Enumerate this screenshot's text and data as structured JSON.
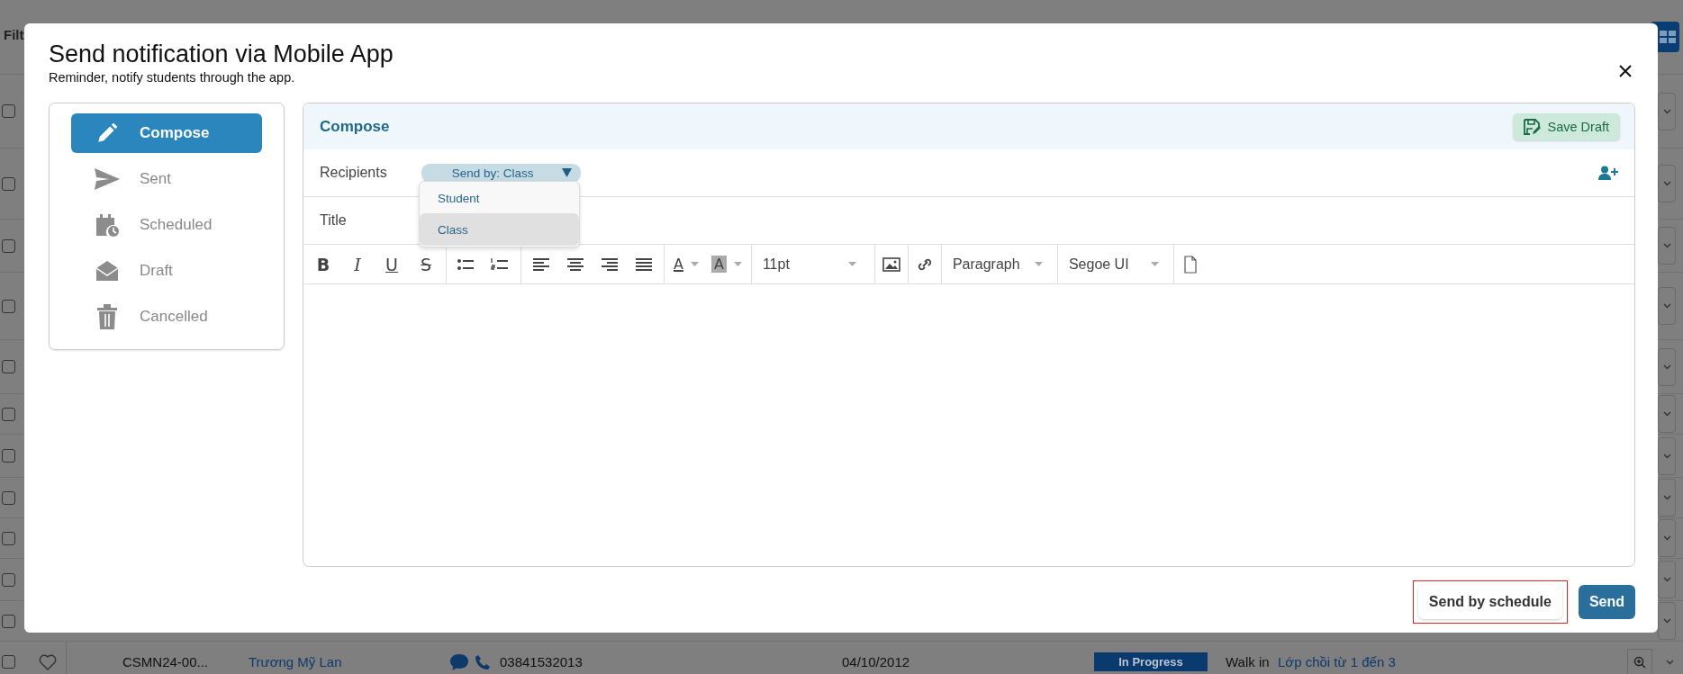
{
  "background": {
    "filter_label": "Filt",
    "rows": [
      {
        "checked": false
      },
      {
        "checked": false
      },
      {
        "checked": false
      },
      {
        "checked": false
      },
      {
        "checked": false
      },
      {
        "checked": false
      },
      {
        "checked": false
      },
      {
        "checked": false
      },
      {
        "checked": false
      },
      {
        "checked": false
      },
      {
        "checked": false
      }
    ],
    "last_row": {
      "checked": false,
      "code": "CSMN24-00...",
      "name": "Trương Mỹ Lan",
      "phone": "03841532013",
      "date": "04/10/2012",
      "status": "In Progress",
      "source": "Walk in",
      "class": "Lớp chồi từ 1 đến 3"
    }
  },
  "dialog": {
    "title": "Send notification via Mobile App",
    "subtitle": "Reminder, notify students through the app.",
    "nav": [
      {
        "label": "Compose",
        "kind": "compose",
        "selected": true
      },
      {
        "label": "Sent",
        "kind": "sent",
        "selected": false
      },
      {
        "label": "Scheduled",
        "kind": "scheduled",
        "selected": false
      },
      {
        "label": "Draft",
        "kind": "draft",
        "selected": false
      },
      {
        "label": "Cancelled",
        "kind": "cancelled",
        "selected": false
      }
    ],
    "compose": {
      "header": "Compose",
      "save_draft": "Save Draft",
      "recipients_label": "Recipients",
      "send_by": "Send by: Class",
      "send_by_options": [
        {
          "label": "Student",
          "selected": false
        },
        {
          "label": "Class",
          "selected": true
        }
      ],
      "title_label": "Title",
      "format_buttons": [
        {
          "label": "B",
          "kind": "bold"
        },
        {
          "label": "I",
          "kind": "italic"
        },
        {
          "label": "U",
          "kind": "underline"
        },
        {
          "label": "S",
          "kind": "strike"
        }
      ],
      "color_buttons": [
        {
          "label": "A",
          "kind": "text_color"
        },
        {
          "label": "A",
          "kind": "highlight"
        }
      ],
      "font_size": "11pt",
      "block_format": "Paragraph",
      "font_family": "Segoe UI"
    },
    "buttons": [
      {
        "label": "Send by schedule",
        "kind": "secondary",
        "highlighted": true
      },
      {
        "label": "Send",
        "kind": "primary",
        "highlighted": false
      }
    ]
  }
}
